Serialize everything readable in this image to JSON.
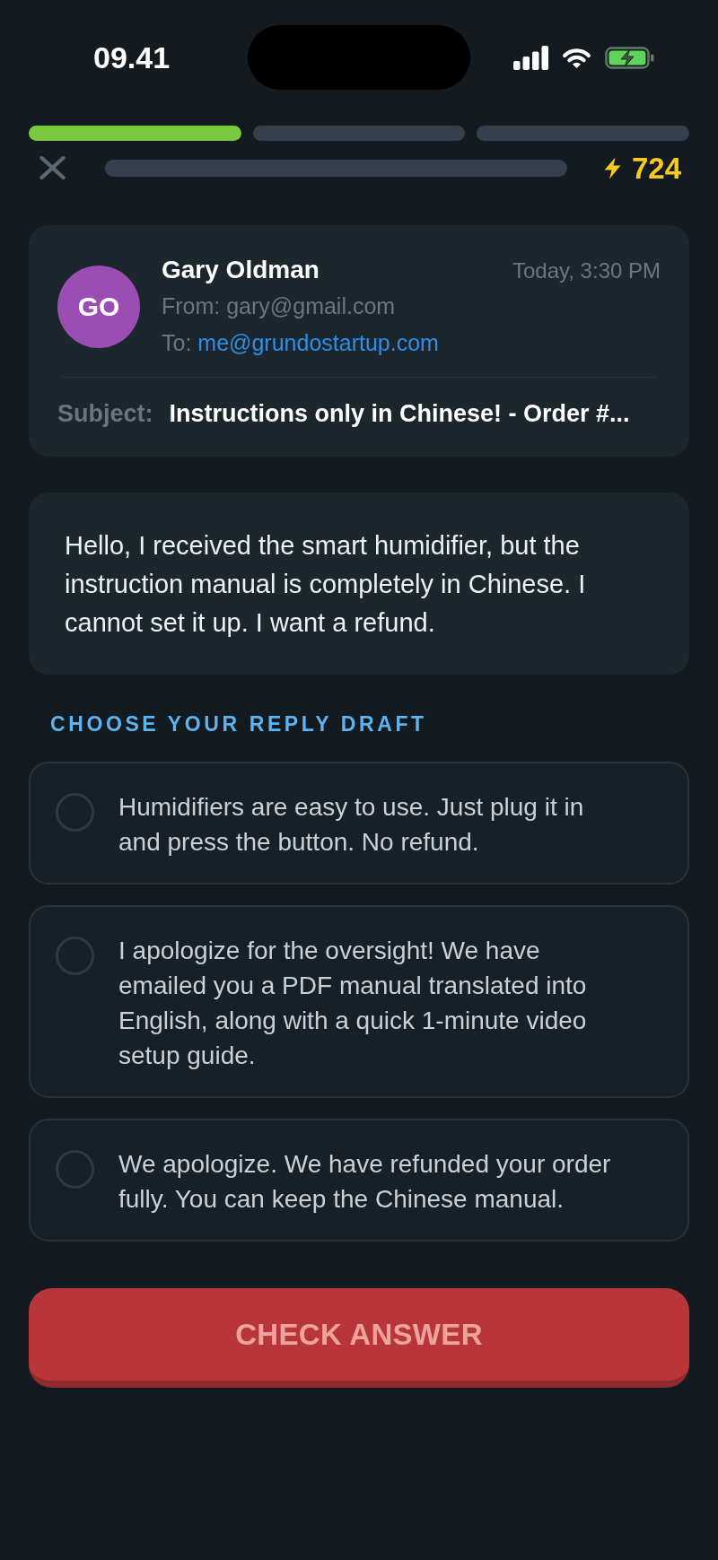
{
  "status_bar": {
    "time": "09.41"
  },
  "lesson_progress": {
    "segments": [
      {
        "complete": true
      },
      {
        "complete": false
      },
      {
        "complete": false
      }
    ]
  },
  "top_bar": {
    "points": "724"
  },
  "email": {
    "avatar_initials": "GO",
    "sender": "Gary Oldman",
    "time": "Today, 3:30 PM",
    "from": "From: gary@gmail.com",
    "to_label": "To:",
    "to_address": "me@grundostartup.com",
    "subject_label": "Subject:",
    "subject": "Instructions only in Chinese! - Order #..."
  },
  "message": {
    "body": "Hello, I received the smart humidifier, but the instruction manual is completely in Chinese. I cannot set it up. I want a refund."
  },
  "replies": {
    "heading": "CHOOSE YOUR REPLY DRAFT",
    "options": [
      {
        "text": "Humidifiers are easy to use. Just plug it in and press the button. No refund.",
        "selected": false
      },
      {
        "text": "I apologize for the oversight! We have emailed you a PDF manual translated into English, along with a quick 1-minute video setup guide.",
        "selected": false
      },
      {
        "text": "We apologize. We have refunded your order fully. You can keep the Chinese manual.",
        "selected": false
      }
    ]
  },
  "check_button": {
    "label": "CHECK ANSWER",
    "disabled": true
  }
}
